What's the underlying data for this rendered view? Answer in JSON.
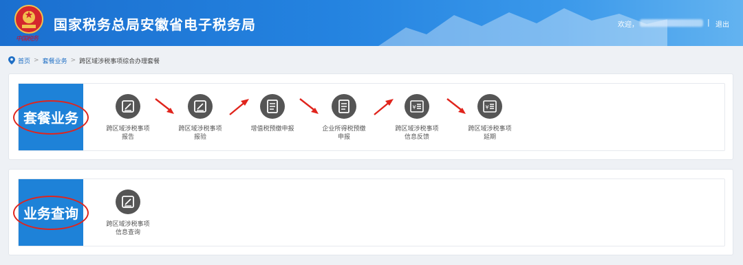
{
  "header": {
    "title": "国家税务总局安徽省电子税务局",
    "sub_logo_text": "中国税务",
    "welcome": "欢迎，",
    "separator": "|",
    "logout": "退出"
  },
  "breadcrumb": {
    "home": "首页",
    "level1": "套餐业务",
    "current": "跨区域涉税事项综合办理套餐",
    "arrow": ">"
  },
  "section1": {
    "label": "套餐业务",
    "items": [
      {
        "line1": "跨区域涉税事项",
        "line2": "报告",
        "icon": "edit-icon"
      },
      {
        "line1": "跨区域涉税事项",
        "line2": "报验",
        "icon": "edit-icon"
      },
      {
        "line1": "增值税预缴申报",
        "line2": "",
        "icon": "document-icon"
      },
      {
        "line1": "企业所得税预缴",
        "line2": "申报",
        "icon": "document-icon"
      },
      {
        "line1": "跨区域涉税事项",
        "line2": "信息反馈",
        "icon": "yuan-list-icon"
      },
      {
        "line1": "跨区域涉税事项",
        "line2": "延期",
        "icon": "yuan-list-icon"
      }
    ]
  },
  "section2": {
    "label": "业务查询",
    "items": [
      {
        "line1": "跨区域涉税事项",
        "line2": "信息查询",
        "icon": "edit-icon"
      }
    ]
  },
  "colors": {
    "header_blue": "#1b6fcf",
    "block_blue": "#1e82d8",
    "icon_gray": "#555555",
    "annotation_red": "#e0241c",
    "link_blue": "#1f6fc5"
  }
}
